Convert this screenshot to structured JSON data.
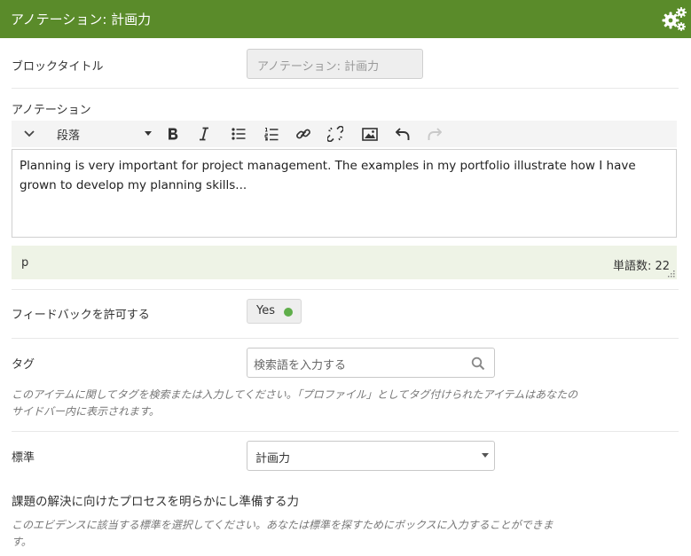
{
  "header": {
    "title": "アノテーション: 計画力",
    "settings_icon": "gears-icon",
    "color": "#5a8b2a"
  },
  "block_title": {
    "label": "ブロックタイトル",
    "value": "アノテーション: 計画力"
  },
  "annotation": {
    "label": "アノテーション",
    "toolbar": {
      "format_select": "段落",
      "icons": [
        "chevron-down-icon",
        "caret-down-icon",
        "bold-icon",
        "italic-icon",
        "bullet-list-icon",
        "numbered-list-icon",
        "link-icon",
        "unlink-icon",
        "image-icon",
        "undo-icon",
        "redo-icon"
      ]
    },
    "content": "Planning is very important for project management. The examples in my portfolio illustrate how I have grown to develop my planning skills...",
    "status_path": "p",
    "word_count": "単語数: 22"
  },
  "feedback": {
    "label": "フィードバックを許可する",
    "value": "Yes",
    "status_color": "#5fae4a"
  },
  "tags": {
    "label": "タグ",
    "placeholder": "検索語を入力する",
    "help_line1": "このアイテムに関してタグを検索または入力してください。「プロファイル」としてタグ付けられたアイテムはあなたの",
    "help_line2": "サイドバー内に表示されます。"
  },
  "standard": {
    "label": "標準",
    "value": "計画力",
    "description_title": "課題の解決に向けたプロセスを明らかにし準備する力",
    "help_line1": "このエビデンスに該当する標準を選択してください。あなたは標準を探すためにボックスに入力することができま",
    "help_line2": "す。"
  }
}
